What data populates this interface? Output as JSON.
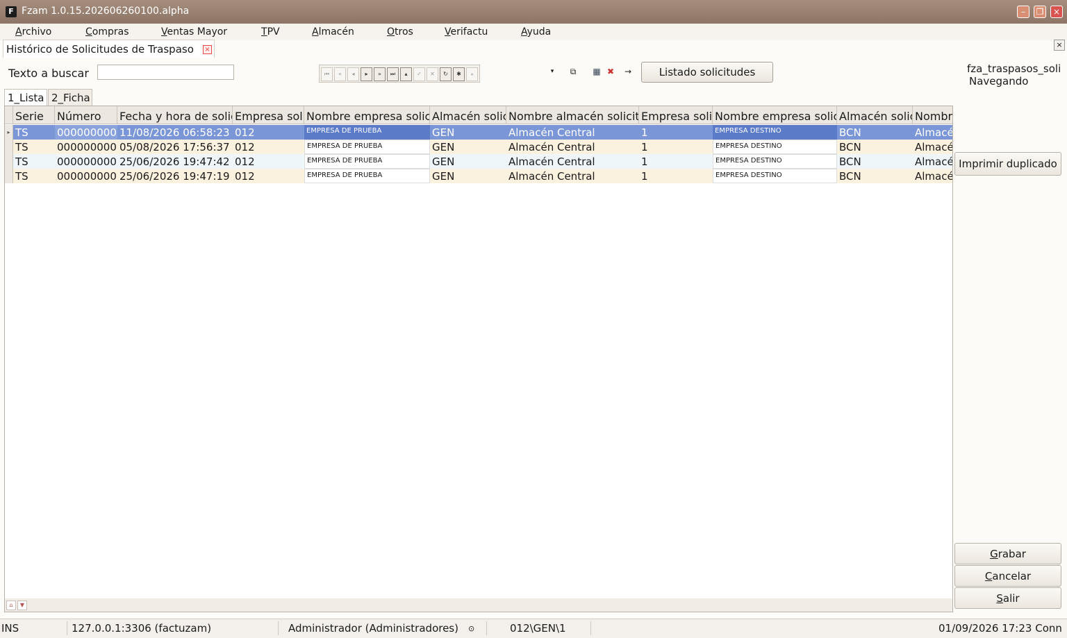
{
  "window": {
    "app_icon": "F",
    "title": "Fzam 1.0.15.202606260100.alpha",
    "min_icon": "minimize-icon",
    "max_icon": "restore-icon",
    "close_icon": "close-icon"
  },
  "menu": [
    {
      "label": "Archivo",
      "key": "A",
      "rest": "rchivo",
      "lead": ""
    },
    {
      "label": "Compras",
      "key": "C",
      "rest": "ompras",
      "lead": ""
    },
    {
      "label": "Ventas Mayor",
      "key": "V",
      "rest": "entas Mayor",
      "lead": ""
    },
    {
      "label": "TPV",
      "key": "T",
      "rest": "PV",
      "lead": ""
    },
    {
      "label": "Almacén",
      "key": "A",
      "rest": "lmacén",
      "lead": ""
    },
    {
      "label": "Otros",
      "key": "O",
      "rest": "tros",
      "lead": ""
    },
    {
      "label": "Verifactu",
      "key": "V",
      "rest": "erifactu",
      "lead": ""
    },
    {
      "label": "Ayuda",
      "key": "A",
      "rest": "yuda",
      "lead": ""
    }
  ],
  "document_tab": {
    "label": "Histórico de Solicitudes de Traspaso",
    "close": "×"
  },
  "panel_close": "×",
  "search": {
    "label": "Texto a buscar",
    "value": ""
  },
  "navigator_icons": [
    "first-icon",
    "prior-page-icon",
    "prior-icon",
    "next-icon",
    "next-page-icon",
    "last-icon",
    "insert-icon",
    "post-icon",
    "cancel-icon",
    "refresh-icon",
    "apply-icon",
    "filter-icon"
  ],
  "toolbar": {
    "dropdown_glyph": "▾",
    "listado_button": "Listado solicitudes"
  },
  "side": {
    "dataset_name": "fza_traspasos_soli",
    "state": "Navegando",
    "print_duplicate": "Imprimir duplicado"
  },
  "tabs": {
    "lista": "1_Lista",
    "ficha": "2_Ficha"
  },
  "grid": {
    "columns": [
      "Serie",
      "Número",
      "Fecha y hora de solici",
      "Empresa solic",
      "Nombre empresa solicit",
      "Almacén solic",
      "Nombre almacén solicita",
      "Empresa solic",
      "Nombre empresa solicit",
      "Almacén solic",
      "Nombr"
    ],
    "rows": [
      [
        "TS",
        "000000000",
        "11/08/2026 06:58:23",
        "012",
        "EMPRESA DE PRUEBA",
        "GEN",
        "Almacén Central",
        "1",
        "EMPRESA DESTINO",
        "BCN",
        "Almacé"
      ],
      [
        "TS",
        "000000000",
        "05/08/2026 17:56:37",
        "012",
        "EMPRESA DE PRUEBA",
        "GEN",
        "Almacén Central",
        "1",
        "EMPRESA DESTINO",
        "BCN",
        "Almacé"
      ],
      [
        "TS",
        "000000000",
        "25/06/2026 19:47:42",
        "012",
        "EMPRESA DE PRUEBA",
        "GEN",
        "Almacén Central",
        "1",
        "EMPRESA DESTINO",
        "BCN",
        "Almacé"
      ],
      [
        "TS",
        "000000000",
        "25/06/2026 19:47:19",
        "012",
        "EMPRESA DE PRUEBA",
        "GEN",
        "Almacén Central",
        "1",
        "EMPRESA DESTINO",
        "BCN",
        "Almacé"
      ]
    ],
    "selected_row": 0,
    "colors": {
      "selected": "#7b96d6",
      "selected_dark": "#5b7bc9",
      "row_alt": "#fbf1df",
      "row_alt2": "#eef6fa"
    }
  },
  "actions": {
    "grabar": {
      "key": "G",
      "rest": "rabar"
    },
    "cancelar": {
      "key": "C",
      "rest": "ancelar"
    },
    "salir": {
      "key": "S",
      "rest": "alir"
    }
  },
  "status": {
    "mode": "INS",
    "connection": "127.0.0.1:3306 (factuzam)",
    "user": "Administrador (Administradores)",
    "location": "012\\GEN\\1",
    "datetime": "01/09/2026 17:23 Conn"
  }
}
